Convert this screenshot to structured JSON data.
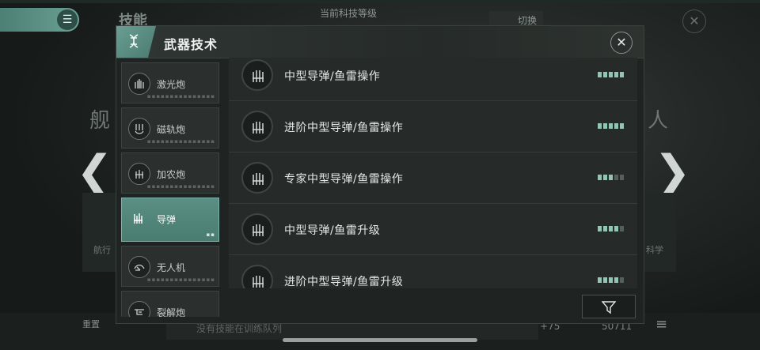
{
  "background": {
    "title": "技能",
    "level_label": "当前科技等级",
    "switch_label": "切换",
    "ship_text": "舰",
    "person_text": "人",
    "card_left": "航行",
    "card_right": "科学",
    "reset_label": "重置",
    "queue_text": "没有技能在训练队列",
    "plus_value": "+75",
    "count_value": "50711"
  },
  "modal": {
    "title": "武器技术",
    "close_icon": "close-icon"
  },
  "sidebar": {
    "items": [
      {
        "label": "激光炮",
        "icon": "laser-cannon-icon",
        "active": false
      },
      {
        "label": "磁轨炮",
        "icon": "railgun-icon",
        "active": false
      },
      {
        "label": "加农炮",
        "icon": "cannon-icon",
        "active": false
      },
      {
        "label": "导弹",
        "icon": "missile-icon",
        "active": true
      },
      {
        "label": "无人机",
        "icon": "drone-icon",
        "active": false
      },
      {
        "label": "裂解炮",
        "icon": "disintegrator-icon",
        "active": false
      }
    ]
  },
  "skills": [
    {
      "label": "中型导弹/鱼雷操作",
      "level": 5,
      "max": 5
    },
    {
      "label": "进阶中型导弹/鱼雷操作",
      "level": 5,
      "max": 5
    },
    {
      "label": "专家中型导弹/鱼雷操作",
      "level": 3,
      "max": 5
    },
    {
      "label": "中型导弹/鱼雷升级",
      "level": 4,
      "max": 5
    },
    {
      "label": "进阶中型导弹/鱼雷升级",
      "level": 4,
      "max": 5
    }
  ],
  "colors": {
    "accent": "#5b8f84",
    "pip_on": "#8fc6b6",
    "pip_off": "#53605c"
  }
}
